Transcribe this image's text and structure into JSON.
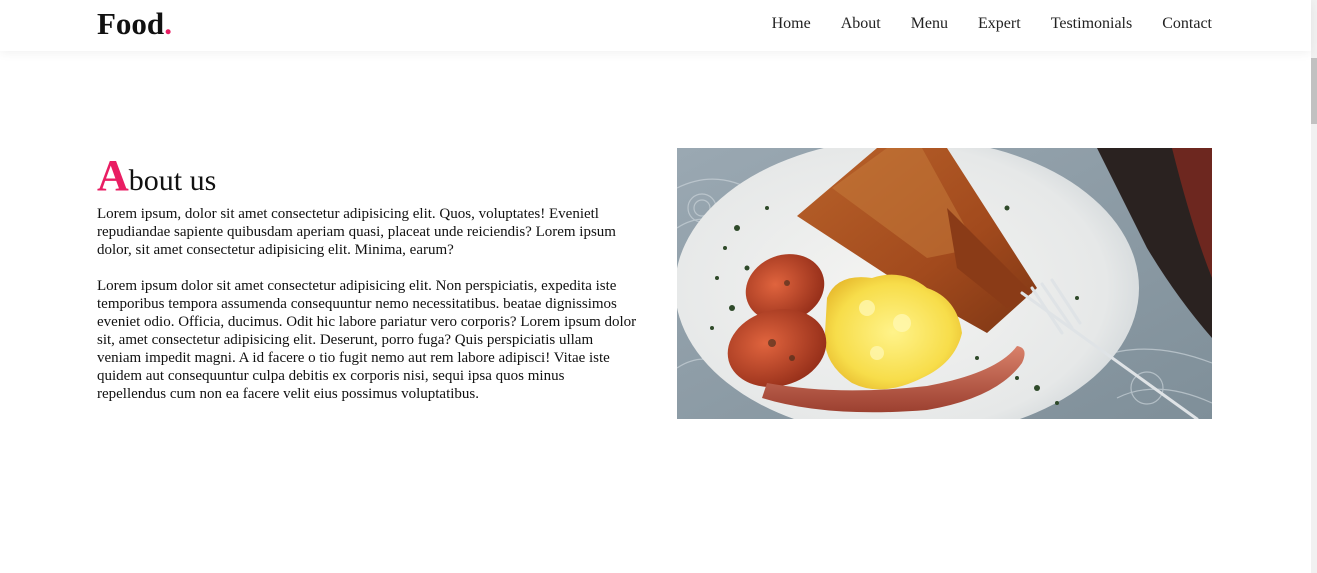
{
  "header": {
    "logo_text": "Food",
    "logo_dot": ".",
    "nav": [
      "Home",
      "About",
      "Menu",
      "Expert",
      "Testimonials",
      "Contact"
    ]
  },
  "about": {
    "title_initial": "A",
    "title_rest": "bout us",
    "paragraph_1": "Lorem ipsum, dolor sit amet consectetur adipisicing elit. Quos, voluptates! Evenietl repudiandae sapiente quibusdam aperiam quasi, placeat unde reiciendis? Lorem ipsum dolor, sit amet consectetur adipisicing elit. Minima, earum?",
    "paragraph_2": "Lorem ipsum dolor sit amet consectetur adipisicing elit. Non perspiciatis, expedita iste temporibus tempora assumenda consequuntur nemo necessitatibus. beatae dignissimos eveniet odio. Officia, ducimus. Odit hic labore pariatur vero corporis? Lorem ipsum dolor sit, amet consectetur adipisicing elit. Deserunt, porro fuga? Quis perspiciatis ullam veniam impedit magni. A id facere o tio fugit nemo aut rem labore adipisci! Vitae iste quidem aut consequuntur culpa debitis ex corporis nisi, sequi ipsa quos minus repellendus cum non ea facere velit eius possimus voluptatibus."
  },
  "colors": {
    "accent": "#e91e63",
    "text": "#111111",
    "background": "#ffffff"
  }
}
